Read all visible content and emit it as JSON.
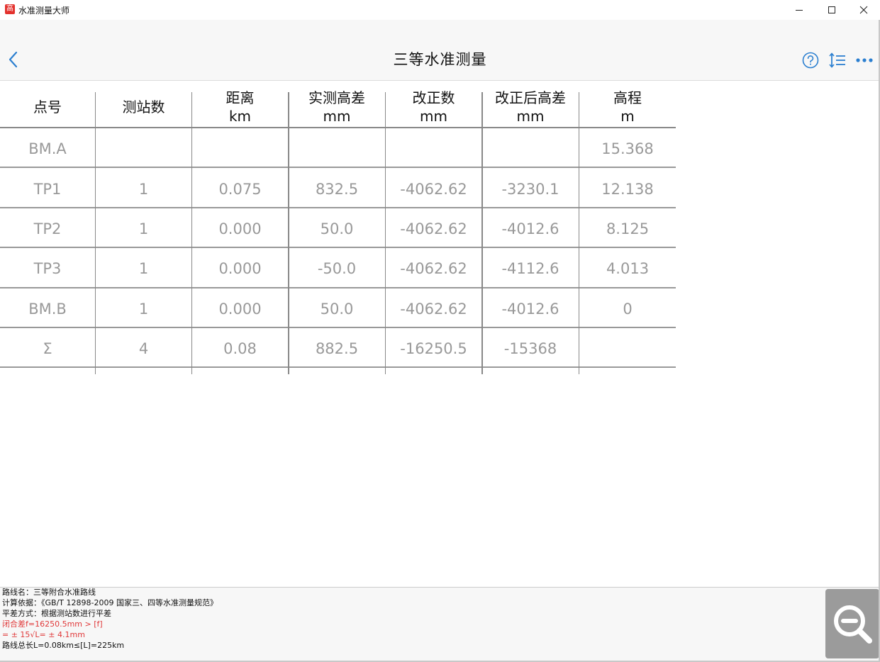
{
  "window": {
    "logo_char": "高",
    "title": "水准测量大师",
    "colors": {
      "logo": "#e3322e",
      "accent": "#2b7fd0",
      "warning": "#e0393a"
    }
  },
  "header": {
    "title": "三等水准测量",
    "icons": [
      "chevron-left-icon",
      "help-circle-icon",
      "sort-lines-icon",
      "more-dots-icon"
    ]
  },
  "table": {
    "columns": [
      {
        "line1": "点号",
        "line2": ""
      },
      {
        "line1": "测站数",
        "line2": ""
      },
      {
        "line1": "距离",
        "line2": "km"
      },
      {
        "line1": "实测高差",
        "line2": "mm"
      },
      {
        "line1": "改正数",
        "line2": "mm"
      },
      {
        "line1": "改正后高差",
        "line2": "mm"
      },
      {
        "line1": "高程",
        "line2": "m"
      }
    ],
    "rows": [
      [
        "BM.A",
        "",
        "",
        "",
        "",
        "",
        "15.368"
      ],
      [
        "TP1",
        "1",
        "0.075",
        "832.5",
        "-4062.62",
        "-3230.1",
        "12.138"
      ],
      [
        "TP2",
        "1",
        "0.000",
        "50.0",
        "-4062.62",
        "-4012.6",
        "8.125"
      ],
      [
        "TP3",
        "1",
        "0.000",
        "-50.0",
        "-4062.62",
        "-4112.6",
        "4.013"
      ],
      [
        "BM.B",
        "1",
        "0.000",
        "50.0",
        "-4062.62",
        "-4012.6",
        "0"
      ],
      [
        "Σ",
        "4",
        "0.08",
        "882.5",
        "-16250.5",
        "-15368",
        ""
      ]
    ]
  },
  "info": {
    "route_name": "路线名：三等附合水准路线",
    "basis": "计算依据：《GB/T 12898-2009 国家三、四等水准测量规范》",
    "method": "平差方式：根据测站数进行平差",
    "closure": "闭合差f=16250.5mm > [f]",
    "tolerance": "= ± 15√L= ± 4.1mm",
    "total_length": "路线总长L=0.08km≤[L]=225km"
  }
}
